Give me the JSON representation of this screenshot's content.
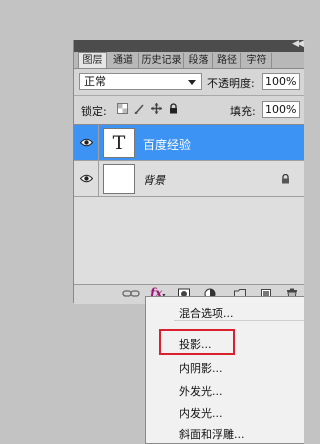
{
  "panel": {
    "tabs": [
      "图层",
      "通道",
      "历史记录",
      "段落",
      "路径",
      "字符"
    ],
    "blend_mode": "正常",
    "opacity_label": "不透明度:",
    "opacity_value": "100%",
    "lock_label": "锁定:",
    "fill_label": "填充:",
    "fill_value": "100%"
  },
  "layers": [
    {
      "name": "百度经验",
      "thumb_text": "T",
      "selected": true,
      "icon": "text-layer-icon"
    },
    {
      "name": "背景",
      "thumb_text": "",
      "selected": false,
      "locked": true
    }
  ],
  "menu": {
    "items": [
      "混合选项...",
      "投影...",
      "内阴影...",
      "外发光...",
      "内发光...",
      "斜面和浮雕..."
    ],
    "highlighted": "投影..."
  },
  "colors": {
    "selection": "#3d93f3",
    "highlight_box": "#d8202f",
    "fx": "#a0147a"
  }
}
